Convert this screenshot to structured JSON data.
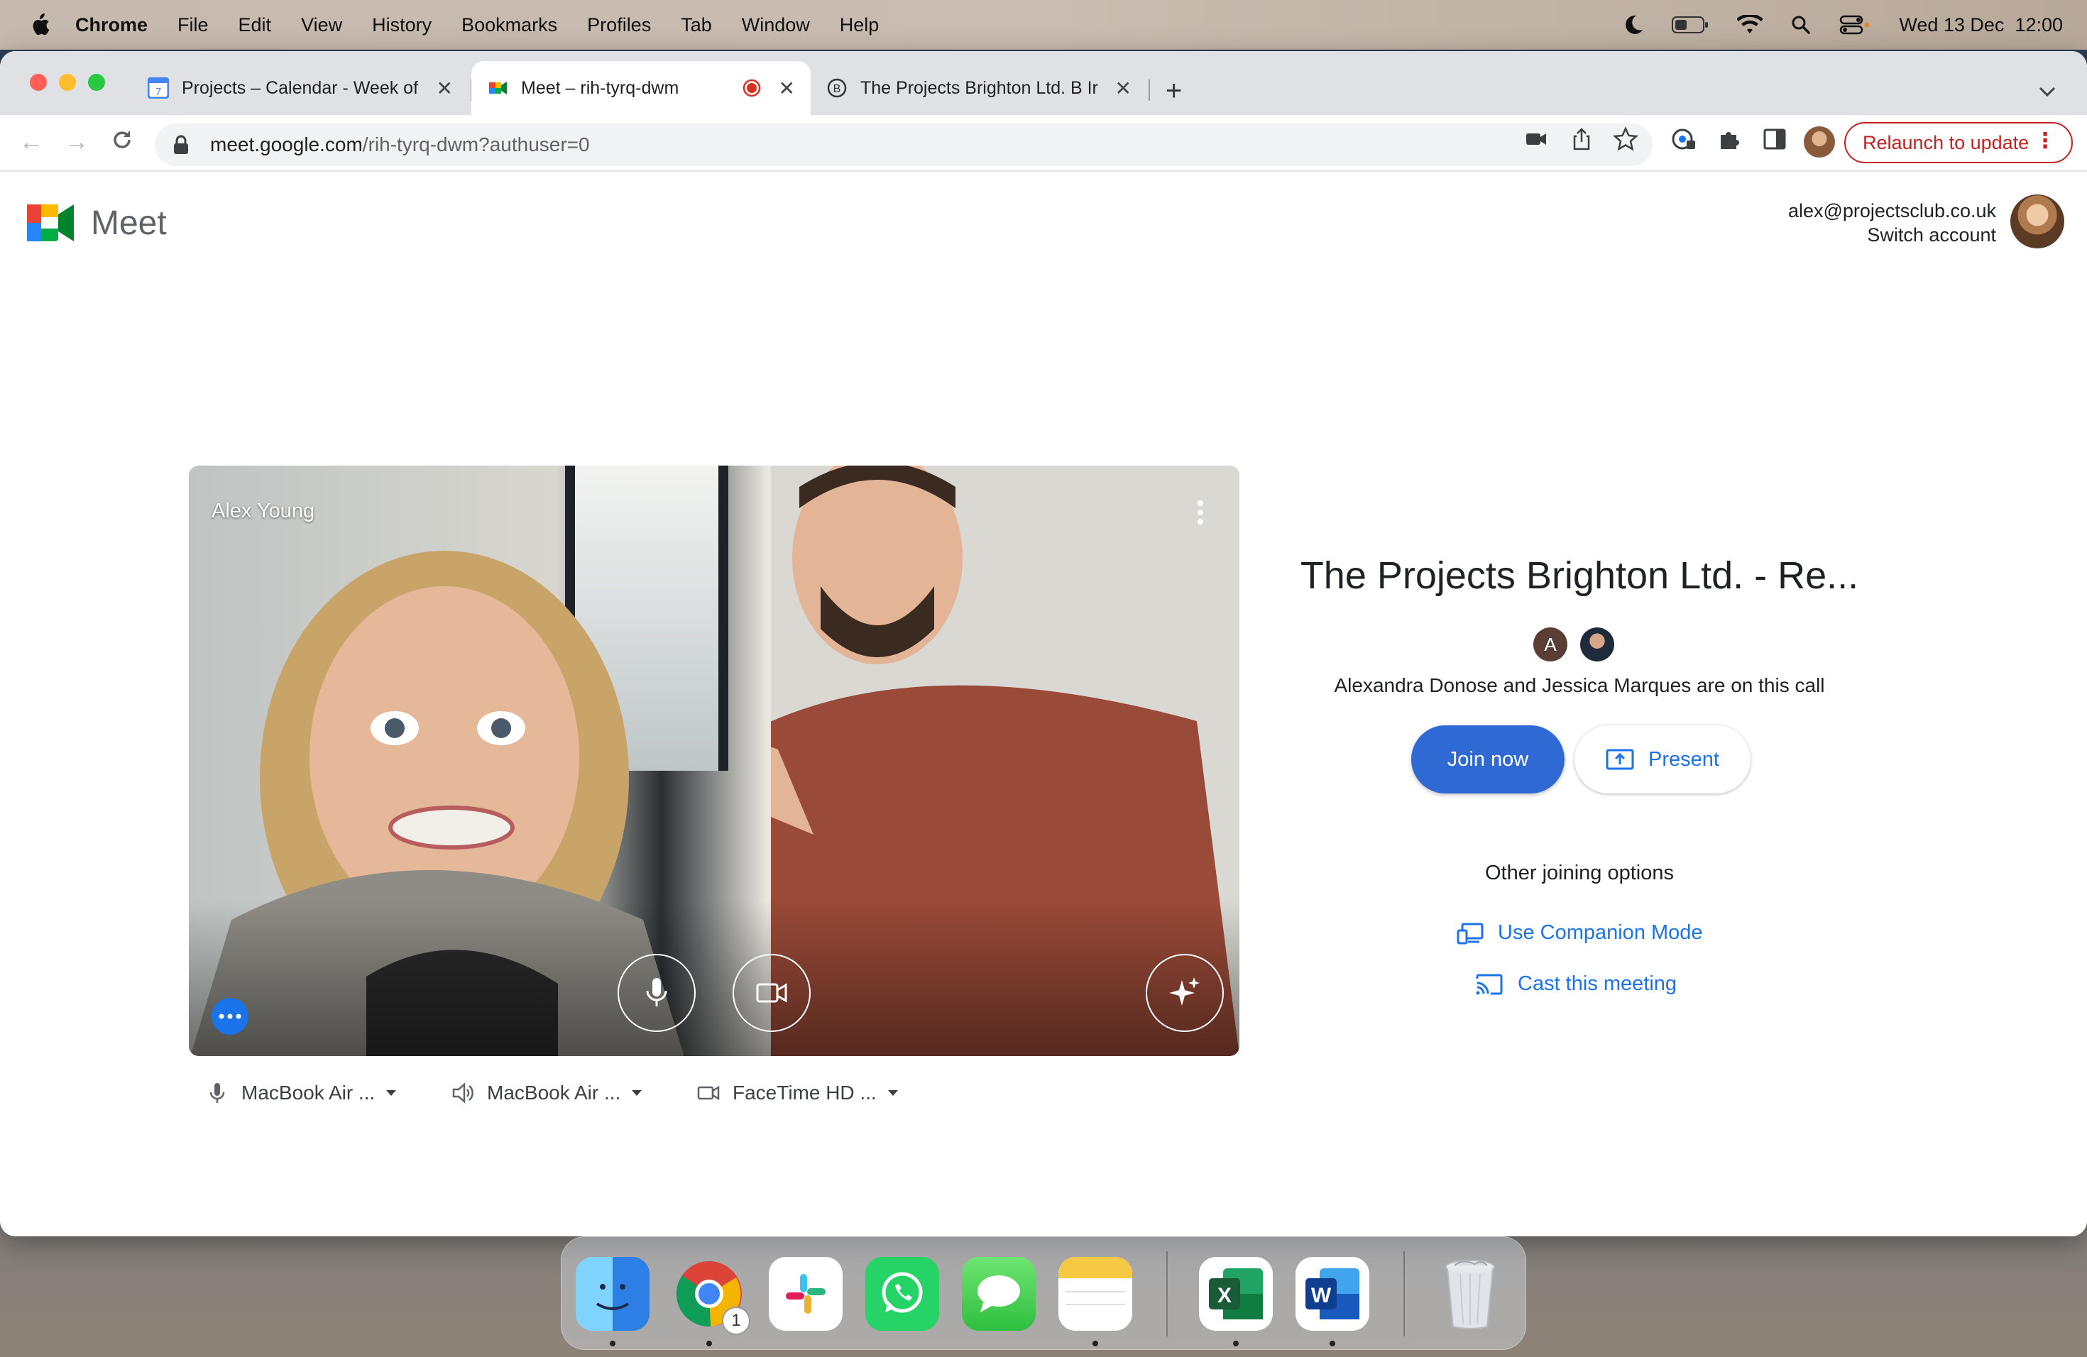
{
  "menubar": {
    "app": "Chrome",
    "items": [
      "File",
      "Edit",
      "View",
      "History",
      "Bookmarks",
      "Profiles",
      "Tab",
      "Window",
      "Help"
    ],
    "datetime": "Wed 13 Dec  12:00"
  },
  "tabs": [
    {
      "title": "Projects – Calendar - Week of",
      "favicon": "calendar-icon",
      "favicon_text": "7",
      "active": false
    },
    {
      "title": "Meet – rih-tyrq-dwm",
      "favicon": "meet-icon",
      "active": true,
      "recording": true
    },
    {
      "title": "The Projects Brighton Ltd. B Ir",
      "favicon": "brighton-icon",
      "favicon_text": "B",
      "active": false
    }
  ],
  "toolbar": {
    "url_host": "meet.google.com",
    "url_path": "/rih-tyrq-dwm?authuser=0",
    "relaunch_label": "Relaunch to update"
  },
  "meet": {
    "logo_text": "Meet",
    "account_email": "alex@projectsclub.co.uk",
    "switch_account": "Switch account",
    "self_name": "Alex Young",
    "meeting_title": "The Projects Brighton Ltd. - Re...",
    "participant_initial": "A",
    "on_call_text": "Alexandra Donose and Jessica Marques are on this call",
    "join_label": "Join now",
    "present_label": "Present",
    "other_options_label": "Other joining options",
    "companion_label": "Use Companion Mode",
    "cast_label": "Cast this meeting",
    "devices": {
      "mic": "MacBook Air ...",
      "speaker": "MacBook Air ...",
      "camera": "FaceTime HD ..."
    }
  },
  "dock": {
    "apps": [
      "Finder",
      "Chrome",
      "Slack",
      "WhatsApp",
      "Messages",
      "Notes",
      "Excel",
      "Word",
      "Trash"
    ],
    "chrome_badge": "1",
    "excel_letter": "X",
    "word_letter": "W"
  },
  "colors": {
    "accent": "#1a73e8",
    "join_button": "#2f69d4",
    "relaunch": "#c5221f",
    "recording": "#d93025"
  }
}
